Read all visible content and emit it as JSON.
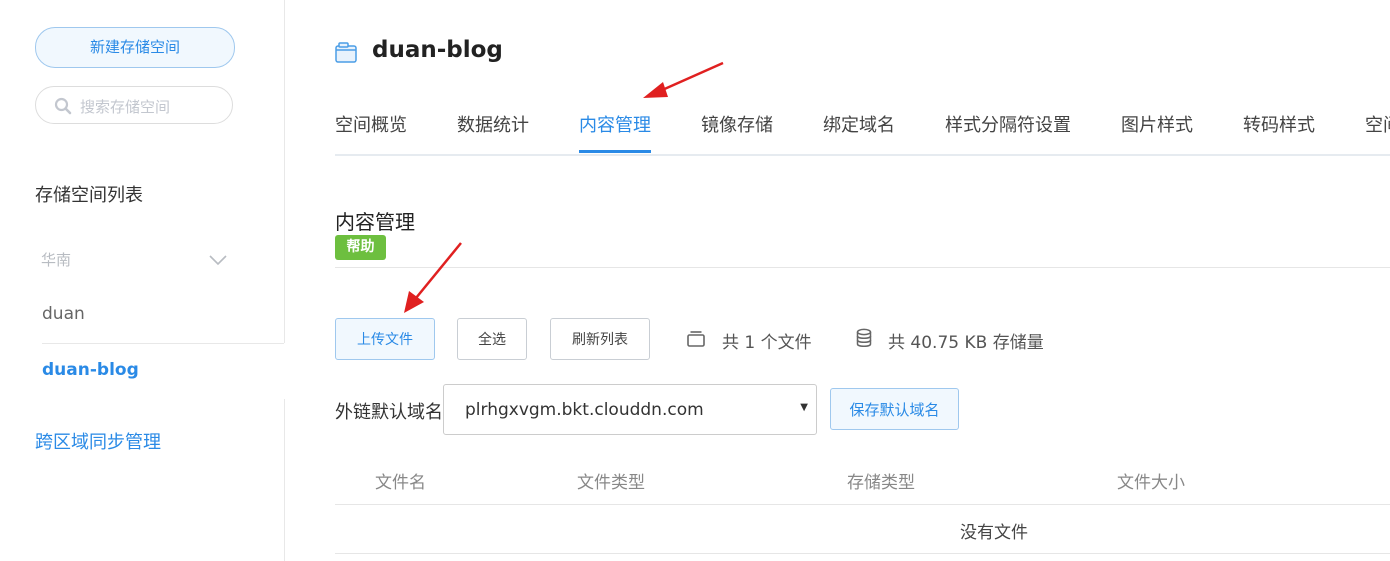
{
  "sidebar": {
    "new_bucket_label": "新建存储空间",
    "search_placeholder": "搜索存储空间",
    "list_title": "存储空间列表",
    "region": "华南",
    "buckets": [
      "duan",
      "duan-blog"
    ],
    "active_bucket": "duan-blog",
    "cross_region_label": "跨区域同步管理"
  },
  "header": {
    "title": "duan-blog"
  },
  "tabs": [
    {
      "label": "空间概览"
    },
    {
      "label": "数据统计"
    },
    {
      "label": "内容管理",
      "active": true
    },
    {
      "label": "镜像存储"
    },
    {
      "label": "绑定域名"
    },
    {
      "label": "样式分隔符设置"
    },
    {
      "label": "图片样式"
    },
    {
      "label": "转码样式"
    },
    {
      "label": "空间"
    }
  ],
  "section": {
    "title": "内容管理",
    "help_badge": "帮助"
  },
  "toolbar": {
    "upload_label": "上传文件",
    "select_all_label": "全选",
    "refresh_label": "刷新列表",
    "file_count_text": "共 1 个文件",
    "storage_text": "共 40.75 KB 存储量"
  },
  "domain": {
    "label": "外链默认域名",
    "selected": "plrhgxvgm.bkt.clouddn.com",
    "save_label": "保存默认域名"
  },
  "table": {
    "headers": [
      "文件名",
      "文件类型",
      "存储类型",
      "文件大小"
    ],
    "empty_text": "没有文件"
  },
  "colors": {
    "accent": "#2a8ae6",
    "help_green": "#6dbf3f",
    "annotation_arrow": "#e02020"
  },
  "icons": [
    "search-icon",
    "chevron-down-icon",
    "bucket-icon",
    "files-icon",
    "database-icon",
    "caret-down-icon"
  ]
}
